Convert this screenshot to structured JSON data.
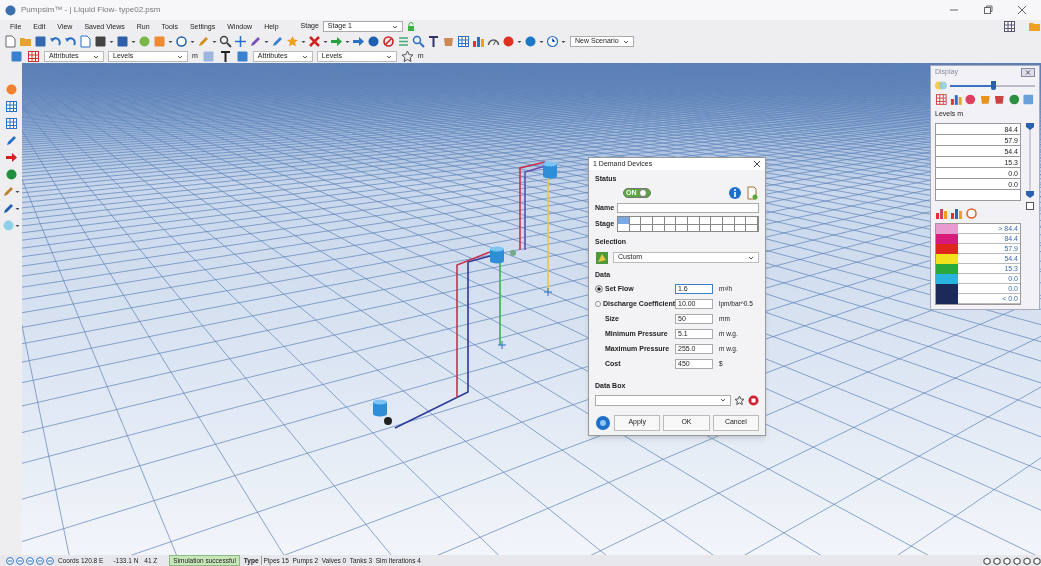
{
  "window": {
    "title": "Pumpsim™ - | Liquid Flow- type02.psm"
  },
  "menu": [
    "File",
    "Edit",
    "View",
    "Saved Views",
    "Run",
    "Tools",
    "Settings",
    "Window",
    "Help"
  ],
  "stage": {
    "label": "Stage",
    "value": "Stage 1"
  },
  "scenario": {
    "value": "New Scenario"
  },
  "label_bar": {
    "left": {
      "attribute": "Attributes",
      "level": "Levels",
      "unit": "m"
    },
    "right": {
      "attribute": "Attributes",
      "level": "Levels",
      "unit": "m"
    }
  },
  "dialog": {
    "title": "1 Demand Devices",
    "status": {
      "label": "Status",
      "on": true,
      "text": "ON"
    },
    "name_label": "Name",
    "stage": {
      "label": "Stage",
      "cells": [
        {
          "selected": true
        },
        {
          "selected": false
        },
        {
          "selected": false
        },
        {
          "selected": false
        },
        {
          "selected": false
        },
        {
          "selected": false
        },
        {
          "selected": false
        },
        {
          "selected": false
        },
        {
          "selected": false
        },
        {
          "selected": false
        },
        {
          "selected": false
        },
        {
          "selected": false
        }
      ]
    },
    "selection": {
      "label": "Selection",
      "value": "Custom"
    },
    "data": {
      "label": "Data",
      "rows": [
        {
          "kind": "radio",
          "label": "Set Flow",
          "selected": true,
          "value": "1.6",
          "unit": "m³/h"
        },
        {
          "kind": "radio",
          "label": "Discharge Coefficient",
          "selected": false,
          "value": "10.00",
          "unit": "lpm/bar^0.5"
        },
        {
          "kind": "plain",
          "label": "Size",
          "value": "50",
          "unit": "mm"
        },
        {
          "kind": "plain",
          "label": "Minimum Pressure",
          "value": "5.1",
          "unit": "m w.g."
        },
        {
          "kind": "plain",
          "label": "Maximum Pressure",
          "value": "255.0",
          "unit": "m w.g."
        },
        {
          "kind": "plain",
          "label": "Cost",
          "value": "450",
          "unit": "$"
        }
      ]
    },
    "data_box_label": "Data Box",
    "buttons": [
      "Apply",
      "OK",
      "Cancel"
    ]
  },
  "display": {
    "title": "Display",
    "slider": {
      "level": 0.5
    },
    "levels_label": "Levels m",
    "levels": [
      "84.4",
      "57.9",
      "54.4",
      "15.3",
      "0.0",
      "0.0"
    ],
    "checkbox_checked": false,
    "legend": [
      {
        "color": "#e79bd0",
        "value": "> 84.4"
      },
      {
        "color": "#d81b7a",
        "value": "84.4"
      },
      {
        "color": "#e0261f",
        "value": "57.9"
      },
      {
        "color": "#f2e21a",
        "value": "54.4"
      },
      {
        "color": "#2aa83a",
        "value": "15.3"
      },
      {
        "color": "#28b4dc",
        "value": "0.0"
      },
      {
        "color": "#1c2a5a",
        "value": "0.0"
      },
      {
        "color": "#1c2a5a",
        "value": "< 0.0"
      }
    ]
  },
  "status_bar": {
    "coords_label": "Coords",
    "x": "120.8 E",
    "y": "-133.1 N",
    "z": "41 Z",
    "simulation": "Simulation successful",
    "type_label": "Type",
    "summary": "Pipes 15  Pumps 2  Valves 0  Tanks 3  Sim Iterations 4"
  }
}
